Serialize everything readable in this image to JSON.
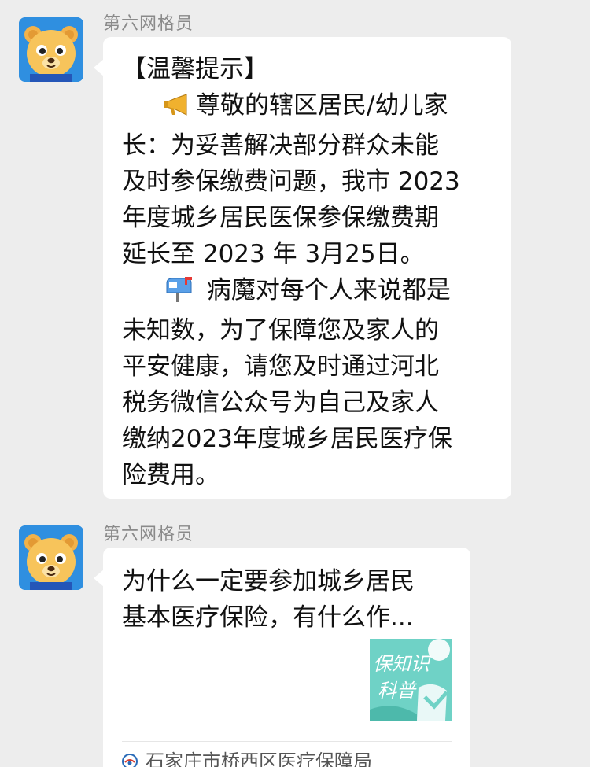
{
  "messages": [
    {
      "sender": "第六网格员",
      "heading": "【温馨提示】",
      "para1_icon": "megaphone-icon",
      "para1_lines": [
        "尊敬的辖区居民/幼儿家",
        "长：为妥善解决部分群众未能",
        "及时参保缴费问题，我市 2023",
        "年度城乡居民医保参保缴费期",
        "延长至 2023 年 3月25日。"
      ],
      "para2_icon": "mailbox-icon",
      "para2_lines": [
        " 病魔对每个人来说都是",
        "未知数，为了保障您及家人的",
        "平安健康，请您及时通过河北",
        "税务微信公众号为自己及家人",
        "缴纳2023年度城乡居民医疗保",
        "险费用。"
      ]
    },
    {
      "sender": "第六网格员",
      "card": {
        "title_lines": [
          "为什么一定要参加城乡居民",
          "基本医疗保险，有什么作..."
        ],
        "thumb_text_1": "保知识",
        "thumb_text_2": "科普",
        "source": "石家庄市桥西区医疗保障局"
      }
    }
  ],
  "colors": {
    "background": "#ededed",
    "bubble": "#ffffff",
    "thumb": "#6fd2c6",
    "avatar": "#2f8fe0"
  }
}
